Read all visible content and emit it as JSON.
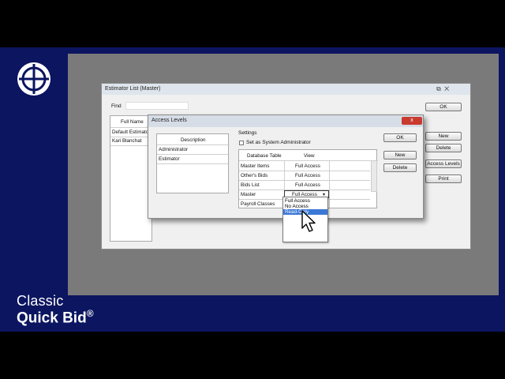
{
  "brand": {
    "line1": "Classic",
    "line2": "Quick Bid",
    "reg": "®"
  },
  "estimator_list": {
    "title": "Estimator List (Master)",
    "find_label": "Find",
    "ok_label": "OK",
    "new_label": "New",
    "delete_label": "Delete",
    "access_levels_label": "Access Levels",
    "print_label": "Print",
    "column_header": "Full Name",
    "rows": [
      "Default Estimator",
      "Kari Blanchat"
    ]
  },
  "access_levels": {
    "title": "Access Levels",
    "close": "x",
    "description_header": "Description",
    "descriptions": [
      "Administrator",
      "Estimator"
    ],
    "settings_label": "Settings",
    "sys_admin_label": "Set as System Administrator",
    "table_header_db": "Database Table",
    "table_header_view": "View",
    "rows": [
      {
        "table": "Master Items",
        "view": "Full Access"
      },
      {
        "table": "Other's Bids",
        "view": "Full Access"
      },
      {
        "table": "Bids List",
        "view": "Full Access"
      },
      {
        "table": "Master",
        "view": "Full Access"
      },
      {
        "table": "Payroll Classes",
        "view": ""
      }
    ],
    "ok_label": "OK",
    "new_label": "New",
    "delete_label": "Delete",
    "dropdown_options": [
      "Full Access",
      "No Access",
      "Read-Only"
    ],
    "dropdown_highlight_index": 2
  }
}
